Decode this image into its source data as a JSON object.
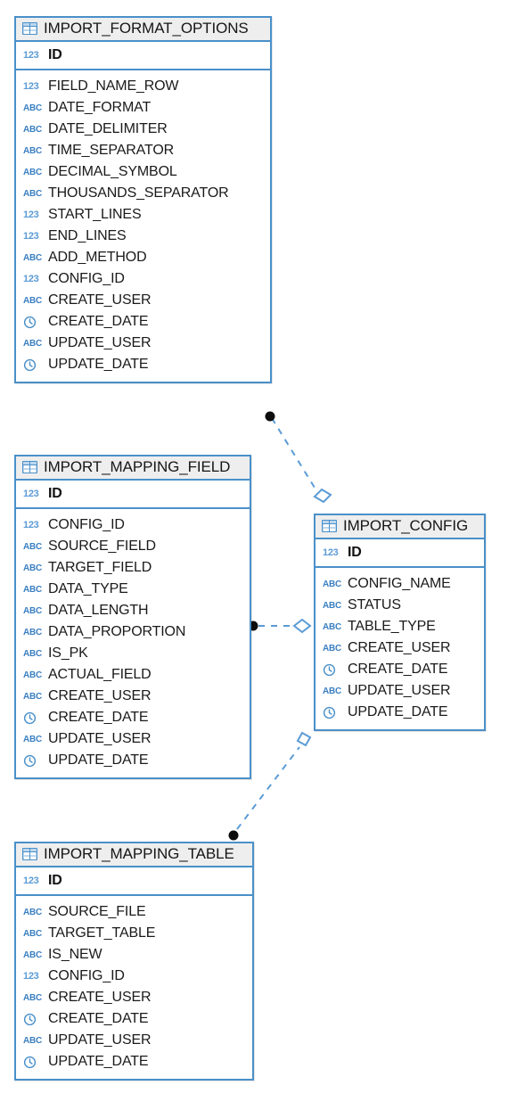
{
  "diagram": {
    "title": "Database ER Diagram",
    "background_color": "#ffffff",
    "accent_color": "#4a90c9",
    "header_bg_color": "#eeeeee",
    "connector_color": "#5b9bd5"
  },
  "entities": [
    {
      "name": "IMPORT_FORMAT_OPTIONS",
      "icon": "table-icon",
      "primary_key": {
        "name": "ID",
        "type_icon": "123"
      },
      "columns": [
        {
          "name": "FIELD_NAME_ROW",
          "type_icon": "123"
        },
        {
          "name": "DATE_FORMAT",
          "type_icon": "ABC"
        },
        {
          "name": "DATE_DELIMITER",
          "type_icon": "ABC"
        },
        {
          "name": "TIME_SEPARATOR",
          "type_icon": "ABC"
        },
        {
          "name": "DECIMAL_SYMBOL",
          "type_icon": "ABC"
        },
        {
          "name": "THOUSANDS_SEPARATOR",
          "type_icon": "ABC"
        },
        {
          "name": "START_LINES",
          "type_icon": "123"
        },
        {
          "name": "END_LINES",
          "type_icon": "123"
        },
        {
          "name": "ADD_METHOD",
          "type_icon": "ABC"
        },
        {
          "name": "CONFIG_ID",
          "type_icon": "123"
        },
        {
          "name": "CREATE_USER",
          "type_icon": "ABC"
        },
        {
          "name": "CREATE_DATE",
          "type_icon": "clock"
        },
        {
          "name": "UPDATE_USER",
          "type_icon": "ABC"
        },
        {
          "name": "UPDATE_DATE",
          "type_icon": "clock"
        }
      ]
    },
    {
      "name": "IMPORT_MAPPING_FIELD",
      "icon": "table-icon",
      "primary_key": {
        "name": "ID",
        "type_icon": "123"
      },
      "columns": [
        {
          "name": "CONFIG_ID",
          "type_icon": "123"
        },
        {
          "name": "SOURCE_FIELD",
          "type_icon": "ABC"
        },
        {
          "name": "TARGET_FIELD",
          "type_icon": "ABC"
        },
        {
          "name": "DATA_TYPE",
          "type_icon": "ABC"
        },
        {
          "name": "DATA_LENGTH",
          "type_icon": "ABC"
        },
        {
          "name": "DATA_PROPORTION",
          "type_icon": "ABC"
        },
        {
          "name": "IS_PK",
          "type_icon": "ABC"
        },
        {
          "name": "ACTUAL_FIELD",
          "type_icon": "ABC"
        },
        {
          "name": "CREATE_USER",
          "type_icon": "ABC"
        },
        {
          "name": "CREATE_DATE",
          "type_icon": "clock"
        },
        {
          "name": "UPDATE_USER",
          "type_icon": "ABC"
        },
        {
          "name": "UPDATE_DATE",
          "type_icon": "clock"
        }
      ]
    },
    {
      "name": "IMPORT_CONFIG",
      "icon": "table-icon",
      "primary_key": {
        "name": "ID",
        "type_icon": "123"
      },
      "columns": [
        {
          "name": "CONFIG_NAME",
          "type_icon": "ABC"
        },
        {
          "name": "STATUS",
          "type_icon": "ABC"
        },
        {
          "name": "TABLE_TYPE",
          "type_icon": "ABC"
        },
        {
          "name": "CREATE_USER",
          "type_icon": "ABC"
        },
        {
          "name": "CREATE_DATE",
          "type_icon": "clock"
        },
        {
          "name": "UPDATE_USER",
          "type_icon": "ABC"
        },
        {
          "name": "UPDATE_DATE",
          "type_icon": "clock"
        }
      ]
    },
    {
      "name": "IMPORT_MAPPING_TABLE",
      "icon": "table-icon",
      "primary_key": {
        "name": "ID",
        "type_icon": "123"
      },
      "columns": [
        {
          "name": "SOURCE_FILE",
          "type_icon": "ABC"
        },
        {
          "name": "TARGET_TABLE",
          "type_icon": "ABC"
        },
        {
          "name": "IS_NEW",
          "type_icon": "ABC"
        },
        {
          "name": "CONFIG_ID",
          "type_icon": "123"
        },
        {
          "name": "CREATE_USER",
          "type_icon": "ABC"
        },
        {
          "name": "CREATE_DATE",
          "type_icon": "clock"
        },
        {
          "name": "UPDATE_USER",
          "type_icon": "ABC"
        },
        {
          "name": "UPDATE_DATE",
          "type_icon": "clock"
        }
      ]
    }
  ],
  "relationships": [
    {
      "from": "IMPORT_FORMAT_OPTIONS",
      "to": "IMPORT_CONFIG",
      "from_marker": "filled-circle",
      "to_marker": "open-diamond",
      "line_style": "dashed"
    },
    {
      "from": "IMPORT_MAPPING_FIELD",
      "to": "IMPORT_CONFIG",
      "from_marker": "filled-circle",
      "to_marker": "open-diamond",
      "line_style": "dashed"
    },
    {
      "from": "IMPORT_MAPPING_TABLE",
      "to": "IMPORT_CONFIG",
      "from_marker": "filled-circle",
      "to_marker": "open-diamond",
      "line_style": "dashed"
    }
  ]
}
